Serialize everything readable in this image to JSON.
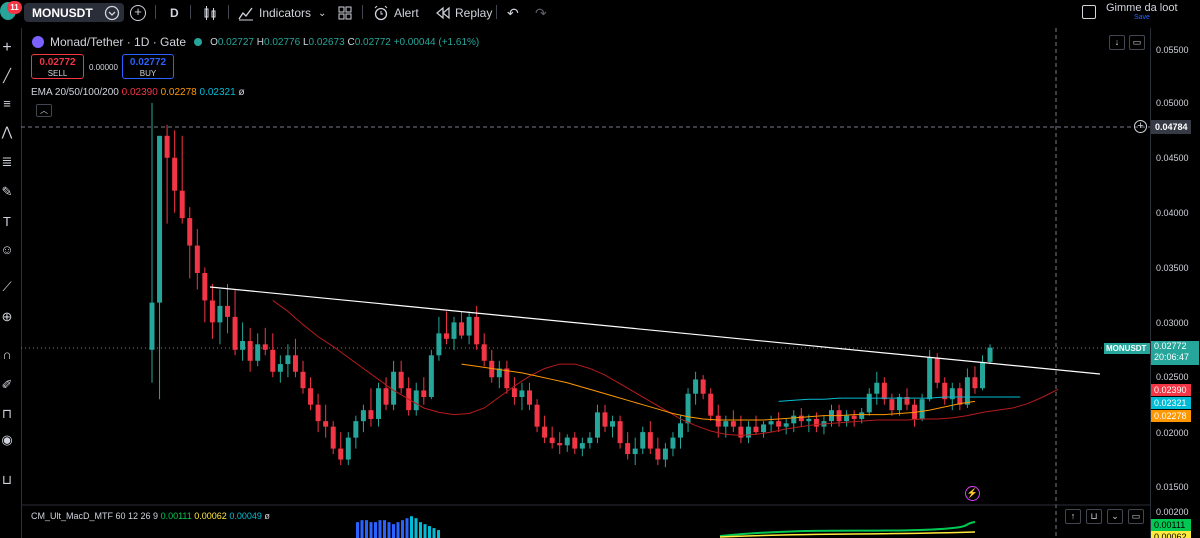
{
  "toolbar": {
    "notification_count": "11",
    "symbol": "MONUSDT",
    "interval": "D",
    "indicators_label": "Indicators",
    "alert_label": "Alert",
    "replay_label": "Replay",
    "layout_name": "Gimme da loot",
    "layout_save": "Save"
  },
  "legend": {
    "title": "Monad/Tether · 1D · Gate",
    "open_label": "O",
    "open": "0.02727",
    "high_label": "H",
    "high": "0.02776",
    "low_label": "L",
    "low": "0.02673",
    "close_label": "C",
    "close": "0.02772",
    "change": "+0.00044 (+1.61%)"
  },
  "trade": {
    "sell_price": "0.02772",
    "sell_label": "SELL",
    "spread": "0.00000",
    "buy_price": "0.02772",
    "buy_label": "BUY"
  },
  "ema": {
    "label": "EMA 20/50/100/200",
    "v1": "0.02390",
    "v2": "0.02278",
    "v3": "0.02321",
    "v4": "ø",
    "colors": {
      "ema20": "#f23645",
      "ema50": "#ff9800",
      "ema100": "#00bcd4",
      "ema200": "#ff6d00"
    }
  },
  "macd": {
    "label": "CM_Ult_MacD_MTF 60 12 26 9",
    "v1": "0.00111",
    "v2": "0.00062",
    "v3": "0.00049",
    "v4": "ø"
  },
  "price_scale": {
    "ticks": [
      "0.05500",
      "0.05000",
      "0.04500",
      "0.04000",
      "0.03500",
      "0.03000",
      "0.02500",
      "0.02000",
      "0.01500",
      "0.00200"
    ],
    "crosshair_price": "0.04784",
    "symbol_tag": "MONUSDT",
    "last_price": "0.02772",
    "countdown": "20:06:47",
    "ema_tags": [
      {
        "value": "0.02390",
        "color": "#f23645"
      },
      {
        "value": "0.02321",
        "color": "#00bcd4"
      },
      {
        "value": "0.02278",
        "color": "#ff9800"
      }
    ],
    "macd_tags": [
      {
        "value": "0.00111",
        "color": "#00c853"
      },
      {
        "value": "0.00062",
        "color": "#ffeb3b"
      }
    ]
  },
  "colors": {
    "up": "#26a69a",
    "down": "#f23645",
    "background": "#000000",
    "trendline": "#ffffff"
  },
  "chart_data": {
    "type": "candlestick",
    "ylim": [
      0.014,
      0.058
    ],
    "candles": [
      [
        0.0275,
        0.05,
        0.0245,
        0.0318
      ],
      [
        0.0318,
        0.044,
        0.023,
        0.047
      ],
      [
        0.047,
        0.048,
        0.039,
        0.045
      ],
      [
        0.045,
        0.0475,
        0.04,
        0.042
      ],
      [
        0.042,
        0.047,
        0.039,
        0.0395
      ],
      [
        0.0395,
        0.0405,
        0.034,
        0.037
      ],
      [
        0.037,
        0.0385,
        0.033,
        0.0345
      ],
      [
        0.0345,
        0.035,
        0.03,
        0.032
      ],
      [
        0.032,
        0.0335,
        0.0285,
        0.03
      ],
      [
        0.03,
        0.033,
        0.028,
        0.0315
      ],
      [
        0.0315,
        0.0335,
        0.029,
        0.0305
      ],
      [
        0.0305,
        0.033,
        0.027,
        0.0275
      ],
      [
        0.0275,
        0.03,
        0.0265,
        0.0283
      ],
      [
        0.0283,
        0.0295,
        0.0255,
        0.0265
      ],
      [
        0.0265,
        0.029,
        0.026,
        0.028
      ],
      [
        0.028,
        0.0295,
        0.027,
        0.0275
      ],
      [
        0.0275,
        0.029,
        0.025,
        0.0255
      ],
      [
        0.0255,
        0.027,
        0.0245,
        0.0262
      ],
      [
        0.0262,
        0.028,
        0.025,
        0.027
      ],
      [
        0.027,
        0.0285,
        0.025,
        0.0255
      ],
      [
        0.0255,
        0.0265,
        0.0235,
        0.024
      ],
      [
        0.024,
        0.025,
        0.022,
        0.0225
      ],
      [
        0.0225,
        0.0235,
        0.02,
        0.021
      ],
      [
        0.021,
        0.0225,
        0.0195,
        0.0205
      ],
      [
        0.0205,
        0.021,
        0.018,
        0.0185
      ],
      [
        0.0185,
        0.02,
        0.017,
        0.0175
      ],
      [
        0.0175,
        0.02,
        0.017,
        0.0195
      ],
      [
        0.0195,
        0.0215,
        0.0185,
        0.021
      ],
      [
        0.021,
        0.0225,
        0.02,
        0.022
      ],
      [
        0.022,
        0.024,
        0.0205,
        0.0212
      ],
      [
        0.0212,
        0.0245,
        0.0205,
        0.024
      ],
      [
        0.024,
        0.025,
        0.022,
        0.0225
      ],
      [
        0.0225,
        0.0265,
        0.022,
        0.0255
      ],
      [
        0.0255,
        0.0265,
        0.0235,
        0.024
      ],
      [
        0.024,
        0.025,
        0.0215,
        0.022
      ],
      [
        0.022,
        0.0245,
        0.0215,
        0.0238
      ],
      [
        0.0238,
        0.025,
        0.0225,
        0.0232
      ],
      [
        0.0232,
        0.0275,
        0.023,
        0.027
      ],
      [
        0.027,
        0.0305,
        0.0265,
        0.029
      ],
      [
        0.029,
        0.031,
        0.028,
        0.0285
      ],
      [
        0.0285,
        0.0305,
        0.0275,
        0.03
      ],
      [
        0.03,
        0.031,
        0.0285,
        0.0288
      ],
      [
        0.0288,
        0.031,
        0.028,
        0.0305
      ],
      [
        0.0305,
        0.0315,
        0.0275,
        0.028
      ],
      [
        0.028,
        0.029,
        0.026,
        0.0265
      ],
      [
        0.0265,
        0.0275,
        0.0245,
        0.025
      ],
      [
        0.025,
        0.0265,
        0.024,
        0.0258
      ],
      [
        0.0258,
        0.0265,
        0.0235,
        0.024
      ],
      [
        0.024,
        0.025,
        0.0225,
        0.0232
      ],
      [
        0.0232,
        0.0245,
        0.022,
        0.0238
      ],
      [
        0.0238,
        0.0245,
        0.022,
        0.0225
      ],
      [
        0.0225,
        0.023,
        0.02,
        0.0205
      ],
      [
        0.0205,
        0.0215,
        0.019,
        0.0195
      ],
      [
        0.0195,
        0.0205,
        0.0185,
        0.019
      ],
      [
        0.019,
        0.02,
        0.018,
        0.0188
      ],
      [
        0.0188,
        0.0198,
        0.0182,
        0.0195
      ],
      [
        0.0195,
        0.02,
        0.018,
        0.0185
      ],
      [
        0.0185,
        0.0195,
        0.0178,
        0.019
      ],
      [
        0.019,
        0.02,
        0.0185,
        0.0195
      ],
      [
        0.0195,
        0.0225,
        0.019,
        0.0218
      ],
      [
        0.0218,
        0.0225,
        0.02,
        0.0205
      ],
      [
        0.0205,
        0.0215,
        0.0195,
        0.021
      ],
      [
        0.021,
        0.0215,
        0.0185,
        0.019
      ],
      [
        0.019,
        0.02,
        0.0175,
        0.018
      ],
      [
        0.018,
        0.0195,
        0.017,
        0.0185
      ],
      [
        0.0185,
        0.0205,
        0.018,
        0.02
      ],
      [
        0.02,
        0.021,
        0.018,
        0.0185
      ],
      [
        0.0185,
        0.0195,
        0.017,
        0.0175
      ],
      [
        0.0175,
        0.019,
        0.0168,
        0.0185
      ],
      [
        0.0185,
        0.02,
        0.0178,
        0.0195
      ],
      [
        0.0195,
        0.0215,
        0.0185,
        0.0208
      ],
      [
        0.0208,
        0.024,
        0.02,
        0.0235
      ],
      [
        0.0235,
        0.0255,
        0.0225,
        0.0248
      ],
      [
        0.0248,
        0.0252,
        0.023,
        0.0235
      ],
      [
        0.0235,
        0.024,
        0.021,
        0.0215
      ],
      [
        0.0215,
        0.0225,
        0.0195,
        0.0205
      ],
      [
        0.0205,
        0.0215,
        0.0195,
        0.021
      ],
      [
        0.021,
        0.022,
        0.02,
        0.0205
      ],
      [
        0.0205,
        0.0215,
        0.019,
        0.0195
      ],
      [
        0.0195,
        0.021,
        0.019,
        0.0205
      ],
      [
        0.0205,
        0.0215,
        0.0198,
        0.02
      ],
      [
        0.02,
        0.021,
        0.0195,
        0.0207
      ],
      [
        0.0207,
        0.0215,
        0.02,
        0.021
      ],
      [
        0.021,
        0.0218,
        0.02,
        0.0205
      ],
      [
        0.0205,
        0.0212,
        0.0198,
        0.0208
      ],
      [
        0.0208,
        0.022,
        0.02,
        0.0215
      ],
      [
        0.0215,
        0.0222,
        0.0205,
        0.021
      ],
      [
        0.021,
        0.0216,
        0.02,
        0.0212
      ],
      [
        0.0212,
        0.0218,
        0.02,
        0.0205
      ],
      [
        0.0205,
        0.0215,
        0.0198,
        0.021
      ],
      [
        0.021,
        0.0225,
        0.0205,
        0.022
      ],
      [
        0.022,
        0.0225,
        0.0205,
        0.021
      ],
      [
        0.021,
        0.022,
        0.0205,
        0.0215
      ],
      [
        0.0215,
        0.022,
        0.0205,
        0.0212
      ],
      [
        0.0212,
        0.0222,
        0.0208,
        0.0218
      ],
      [
        0.0218,
        0.024,
        0.0215,
        0.0235
      ],
      [
        0.0235,
        0.0255,
        0.0225,
        0.0245
      ],
      [
        0.0245,
        0.025,
        0.0225,
        0.023
      ],
      [
        0.023,
        0.0235,
        0.0215,
        0.022
      ],
      [
        0.022,
        0.0235,
        0.0215,
        0.0232
      ],
      [
        0.0232,
        0.024,
        0.022,
        0.0225
      ],
      [
        0.0225,
        0.023,
        0.0205,
        0.0212
      ],
      [
        0.0212,
        0.0235,
        0.021,
        0.023
      ],
      [
        0.023,
        0.0275,
        0.0228,
        0.0268
      ],
      [
        0.0268,
        0.0272,
        0.024,
        0.0245
      ],
      [
        0.0245,
        0.025,
        0.0225,
        0.023
      ],
      [
        0.023,
        0.0245,
        0.022,
        0.024
      ],
      [
        0.024,
        0.0245,
        0.022,
        0.0225
      ],
      [
        0.0225,
        0.0258,
        0.0222,
        0.025
      ],
      [
        0.025,
        0.026,
        0.0235,
        0.024
      ],
      [
        0.024,
        0.027,
        0.0238,
        0.0264
      ],
      [
        0.0264,
        0.028,
        0.0262,
        0.0277
      ]
    ],
    "ema20": [
      0.032,
      0.031,
      0.0298,
      0.0287,
      0.0278,
      0.0268,
      0.0258,
      0.0248,
      0.0238,
      0.023,
      0.0222,
      0.0218,
      0.0216,
      0.0217,
      0.0222,
      0.0232,
      0.0242,
      0.0251,
      0.0258,
      0.0262,
      0.0262,
      0.0258,
      0.0252,
      0.0244,
      0.0236,
      0.0228,
      0.022,
      0.0212,
      0.0206,
      0.0201,
      0.0198,
      0.0197,
      0.0198,
      0.02,
      0.0203,
      0.0205,
      0.0207,
      0.0208,
      0.0209,
      0.021,
      0.0211,
      0.0211,
      0.0211,
      0.0212,
      0.0212,
      0.0213,
      0.0215,
      0.0218,
      0.022,
      0.0222,
      0.0226,
      0.0232,
      0.0239
    ],
    "ema50": [
      0.0262,
      0.026,
      0.0258,
      0.0256,
      0.0254,
      0.0251,
      0.0248,
      0.0245,
      0.0241,
      0.0237,
      0.0233,
      0.0229,
      0.0225,
      0.0221,
      0.0217,
      0.0214,
      0.0212,
      0.0211,
      0.0211,
      0.0211,
      0.0211,
      0.0212,
      0.0213,
      0.0214,
      0.0215,
      0.0215,
      0.0216,
      0.0216,
      0.0216,
      0.0217,
      0.0218,
      0.022,
      0.0223,
      0.0226,
      0.0228
    ],
    "ema100": [
      0.0228,
      0.0229,
      0.023,
      0.023,
      0.0231,
      0.0231,
      0.0231,
      0.0231,
      0.0231,
      0.0231,
      0.0231,
      0.0232,
      0.0232,
      0.0232,
      0.0232,
      0.0232,
      0.0232
    ],
    "trendline": [
      [
        0.0335,
        0.0258
      ]
    ],
    "macd_histogram": [
      0.0008,
      0.0009,
      0.0009,
      0.0008,
      0.0008,
      0.0009,
      0.0009,
      0.0008,
      0.0007,
      0.0008,
      0.0009,
      0.001,
      0.0011,
      0.001,
      0.0008,
      0.0007,
      0.0006,
      0.0005,
      0.0004
    ]
  }
}
